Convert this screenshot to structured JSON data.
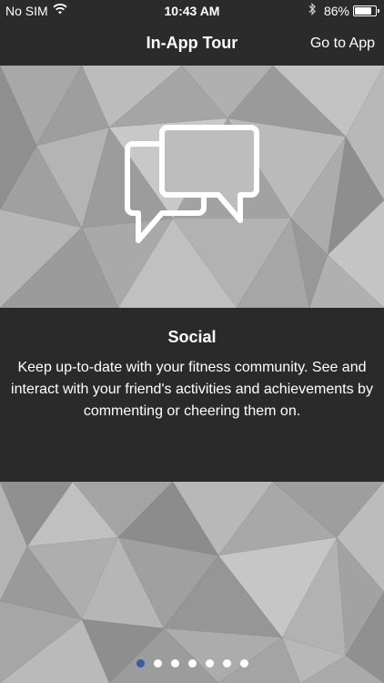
{
  "status_bar": {
    "carrier": "No SIM",
    "time": "10:43 AM",
    "battery_percent": "86%",
    "battery_level": 0.86,
    "icons": [
      "wifi-icon",
      "bluetooth-icon",
      "battery-icon"
    ]
  },
  "nav": {
    "title": "In-App Tour",
    "action_label": "Go to App"
  },
  "slide": {
    "icon": "chat-bubbles-icon",
    "title": "Social",
    "body": "Keep up-to-date with your fitness community. See and interact with your friend's activities and achievements by commenting or cheering them on."
  },
  "pager": {
    "page_count": 7,
    "current_page": 1,
    "active_color": "#3a5ba6",
    "inactive_color": "#ffffff"
  },
  "colors": {
    "chrome": "#2b2b2b",
    "panel": "#2a2a2a",
    "text": "#ffffff"
  }
}
